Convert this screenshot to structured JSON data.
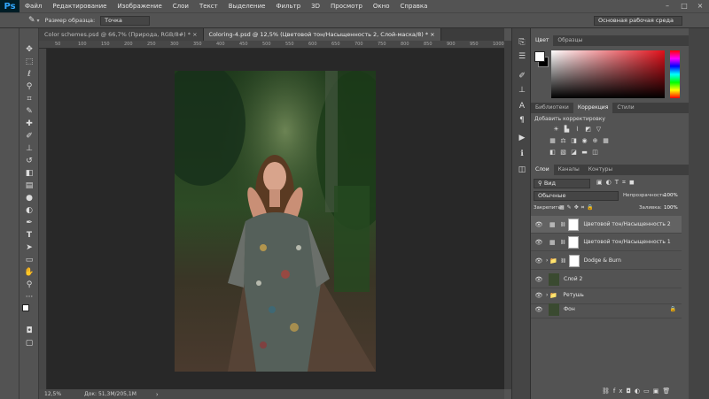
{
  "app": {
    "logo": "Ps"
  },
  "menu": [
    "Файл",
    "Редактирование",
    "Изображение",
    "Слои",
    "Текст",
    "Выделение",
    "Фильтр",
    "3D",
    "Просмотр",
    "Окно",
    "Справка"
  ],
  "window_controls": [
    "–",
    "□",
    "×"
  ],
  "options": {
    "tool_icon": "eyedropper-icon",
    "sample_label": "Размер образца:",
    "sample_value": "Точка",
    "workspace": "Основная рабочая среда"
  },
  "tabs": [
    {
      "label": "Color schemes.psd @ 66,7% (Природа, RGB/8#) *",
      "close": "×"
    },
    {
      "label": "Coloring-4.psd @ 12,5% (Цветовой тон/Насыщенность 2, Слой-маска/8) *",
      "close": "×"
    }
  ],
  "ruler_ticks": [
    "50",
    "100",
    "150",
    "200",
    "250",
    "300",
    "350",
    "400",
    "450",
    "500",
    "550",
    "600",
    "650",
    "700",
    "750",
    "800",
    "850",
    "900",
    "950",
    "1000"
  ],
  "status": {
    "zoom": "12,5%",
    "doc": "Док: 51,3M/205,1M"
  },
  "color_panel": {
    "tabs": [
      "Цвет",
      "Образцы"
    ],
    "fg": "#ffffff",
    "bg": "#000000"
  },
  "adjust_panel": {
    "tabs": [
      "Библиотеки",
      "Коррекция",
      "Стили"
    ],
    "title": "Добавить корректировку"
  },
  "layers_panel": {
    "tabs": [
      "Слои",
      "Каналы",
      "Контуры"
    ],
    "filter": "Вид",
    "blend_mode": "Обычные",
    "opacity_label": "Непрозрачность:",
    "opacity": "100%",
    "lock_label": "Закрепить:",
    "fill_label": "Заливка:",
    "fill": "100%",
    "layers": [
      {
        "name": "Цветовой тон/Насыщенность 2",
        "type": "adjustment",
        "selected": true
      },
      {
        "name": "Цветовой тон/Насыщенность 1",
        "type": "adjustment",
        "selected": false
      },
      {
        "name": "Dodge & Burn",
        "type": "group",
        "selected": false
      },
      {
        "name": "Слой 2",
        "type": "photo",
        "selected": false
      },
      {
        "name": "Ретушь",
        "type": "folder",
        "selected": false
      },
      {
        "name": "Фон",
        "type": "photo-locked",
        "selected": false
      }
    ]
  }
}
